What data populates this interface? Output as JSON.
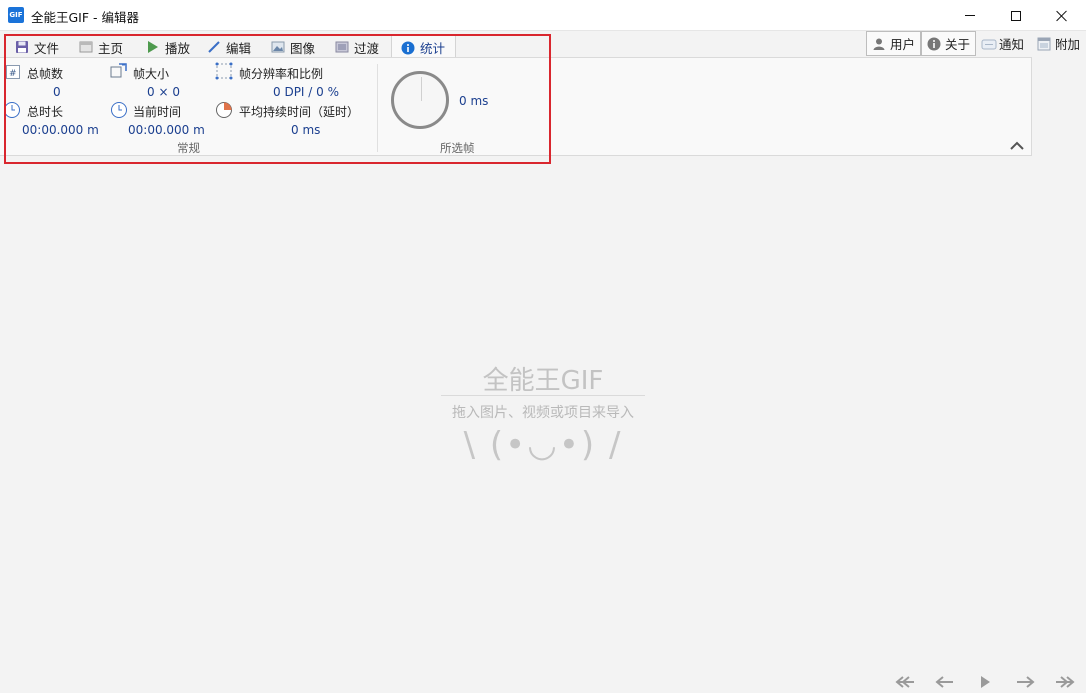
{
  "window": {
    "app_icon_text": "GIF",
    "title": "全能王GIF - 编辑器"
  },
  "tabs": [
    {
      "label": "文件",
      "icon": "save-icon"
    },
    {
      "label": "主页",
      "icon": "home-icon"
    },
    {
      "label": "播放",
      "icon": "play-icon"
    },
    {
      "label": "编辑",
      "icon": "pencil-icon"
    },
    {
      "label": "图像",
      "icon": "image-icon"
    },
    {
      "label": "过渡",
      "icon": "transition-icon"
    },
    {
      "label": "统计",
      "icon": "info-icon",
      "active": true
    }
  ],
  "right_buttons": [
    {
      "label": "用户",
      "icon": "user-icon"
    },
    {
      "label": "关于",
      "icon": "info-icon"
    },
    {
      "label": "通知",
      "icon": "message-icon"
    },
    {
      "label": "附加",
      "icon": "window-icon"
    }
  ],
  "stats": {
    "total_frames_label": "总帧数",
    "total_frames_value": "0",
    "frame_size_label": "帧大小",
    "frame_size_value": "0 × 0",
    "resolution_label": "帧分辨率和比例",
    "resolution_value": "0 DPI / 0 %",
    "total_duration_label": "总时长",
    "total_duration_value": "00:00.000 m",
    "current_time_label": "当前时间",
    "current_time_value": "00:00.000 m",
    "avg_duration_label": "平均持续时间（延时）",
    "avg_duration_value": "0 ms",
    "group_general": "常规",
    "selected_value": "0 ms",
    "group_selected": "所选帧"
  },
  "placeholder": {
    "title": "全能王GIF",
    "subtitle": "拖入图片、视频或项目来导入",
    "face": "\\ (•◡•) /"
  },
  "colors": {
    "accent": "#1b3f8f",
    "highlight": "#d9262e",
    "info_blue": "#1a6fd1"
  }
}
